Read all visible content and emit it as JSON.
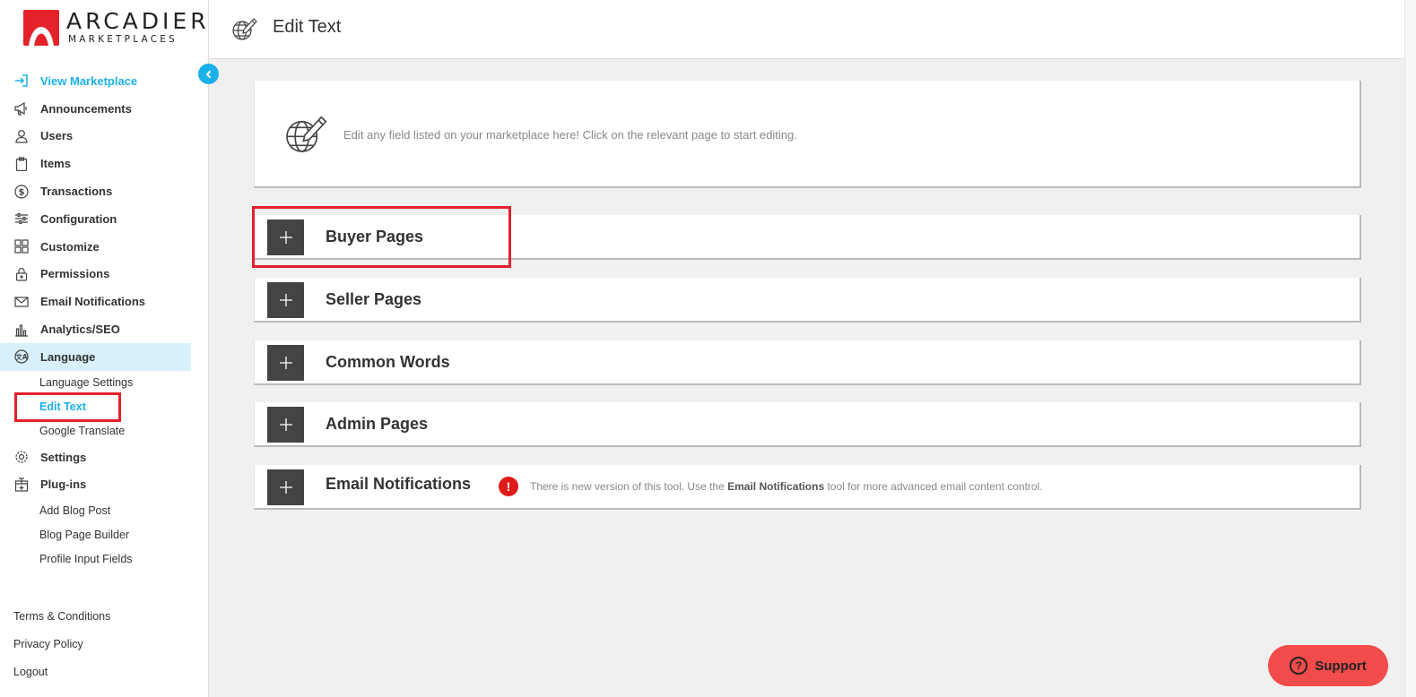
{
  "brand": {
    "name": "ARCADIER",
    "sub": "MARKETPLACES",
    "color": "#e3222b"
  },
  "header": {
    "title": "Edit Text",
    "icon": "globe-pencil-icon"
  },
  "sidebar": {
    "items": [
      {
        "label": "View Marketplace",
        "icon": "enter-icon"
      },
      {
        "label": "Announcements",
        "icon": "megaphone-icon"
      },
      {
        "label": "Users",
        "icon": "user-icon"
      },
      {
        "label": "Items",
        "icon": "clipboard-icon"
      },
      {
        "label": "Transactions",
        "icon": "dollar-icon"
      },
      {
        "label": "Configuration",
        "icon": "sliders-icon"
      },
      {
        "label": "Customize",
        "icon": "grid-icon"
      },
      {
        "label": "Permissions",
        "icon": "lock-icon"
      },
      {
        "label": "Email Notifications",
        "icon": "mail-icon"
      },
      {
        "label": "Analytics/SEO",
        "icon": "bar-chart-icon"
      },
      {
        "label": "Language",
        "icon": "translate-icon"
      }
    ],
    "language_sub": [
      "Language Settings",
      "Edit Text",
      "Google Translate"
    ],
    "settings": {
      "label": "Settings",
      "icon": "gear-icon"
    },
    "plugins": {
      "label": "Plug-ins",
      "icon": "plugin-icon"
    },
    "plugins_sub": [
      "Add Blog Post",
      "Blog Page Builder",
      "Profile Input Fields"
    ],
    "footer": [
      "Terms & Conditions",
      "Privacy Policy",
      "Logout"
    ]
  },
  "intro": {
    "text": "Edit any field listed on your marketplace here! Click on the relevant page to start editing."
  },
  "sections": [
    {
      "title": "Buyer Pages"
    },
    {
      "title": "Seller Pages"
    },
    {
      "title": "Common Words"
    },
    {
      "title": "Admin Pages"
    },
    {
      "title": "Email Notifications"
    }
  ],
  "email_note": {
    "pre": "There is new version of this tool. Use the ",
    "bold": "Email Notifications",
    "post": " tool for more advanced email content control."
  },
  "support": {
    "label": "Support"
  },
  "colors": {
    "accent": "#1ab0e8",
    "highlight": "#e3222b",
    "support": "#f24b4b"
  }
}
